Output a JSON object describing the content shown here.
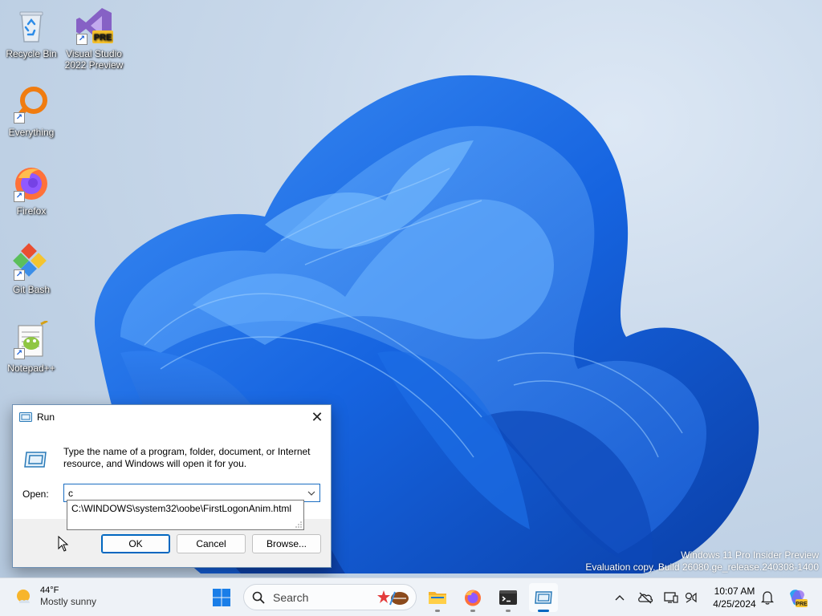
{
  "desktop": {
    "icons": [
      {
        "label": "Recycle Bin",
        "icon": "recycle-bin-icon"
      },
      {
        "label": "Visual Studio 2022 Preview",
        "label_line1": "Visual Studio",
        "label_line2": "2022 Preview",
        "icon": "visual-studio-icon",
        "badge": "PRE"
      },
      {
        "label": "Everything",
        "icon": "everything-search-icon"
      },
      {
        "label": "Firefox",
        "icon": "firefox-icon"
      },
      {
        "label": "Git Bash",
        "icon": "git-bash-icon"
      },
      {
        "label": "Notepad++",
        "icon": "notepad-plus-plus-icon"
      }
    ],
    "watermark": {
      "line1": "Windows 11 Pro Insider Preview",
      "line2": "Evaluation copy. Build 26080.ge_release.240308-1400"
    }
  },
  "run_dialog": {
    "title": "Run",
    "close_glyph": "✕",
    "description": "Type the name of a program, folder, document, or Internet resource, and Windows will open it for you.",
    "open_label": "Open:",
    "open_value": "c",
    "autocomplete": [
      "C:\\WINDOWS\\system32\\oobe\\FirstLogonAnim.html"
    ],
    "buttons": {
      "ok": "OK",
      "cancel": "Cancel",
      "browse": "Browse..."
    }
  },
  "taskbar": {
    "weather": {
      "temp": "44°F",
      "condition": "Mostly sunny",
      "icon": "sun-cloud-icon"
    },
    "search_label": "Search",
    "apps": [
      {
        "name": "start",
        "icon": "windows-logo-icon"
      },
      {
        "name": "file-explorer",
        "icon": "folder-icon"
      },
      {
        "name": "firefox",
        "icon": "firefox-icon"
      },
      {
        "name": "terminal",
        "icon": "terminal-icon"
      },
      {
        "name": "run",
        "icon": "run-icon",
        "active": true
      }
    ],
    "tray": [
      "chevron-up-icon",
      "onedrive-offline-icon",
      "display-icon",
      "network-volume-icon"
    ],
    "clock": {
      "time": "10:07 AM",
      "date": "4/25/2024"
    },
    "colors": {
      "accent": "#0067c0",
      "taskbar_bg": "#eef2f7"
    }
  }
}
